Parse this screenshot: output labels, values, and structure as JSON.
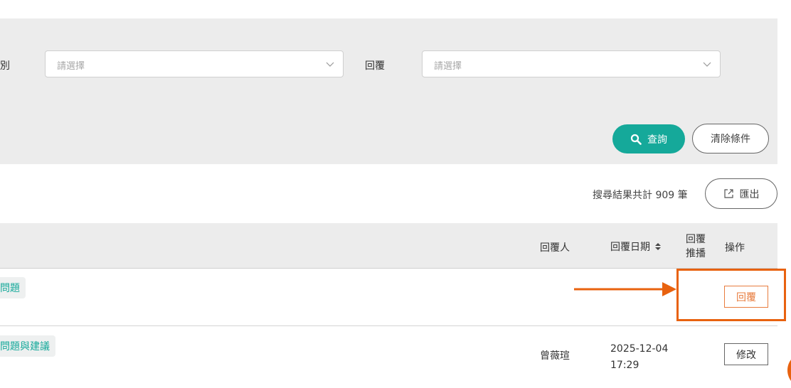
{
  "filters": {
    "category_label_partial": "別",
    "category_placeholder": "請選擇",
    "reply_label": "回覆",
    "reply_placeholder": "請選擇",
    "query_button": "查詢",
    "clear_button": "清除條件"
  },
  "results": {
    "count_text": "搜尋結果共計 909 筆",
    "export_button": "匯出"
  },
  "table": {
    "headers": {
      "replier": "回覆人",
      "reply_date": "回覆日期",
      "reply_push_line1": "回覆",
      "reply_push_line2": "推播",
      "actions": "操作"
    },
    "rows": [
      {
        "tag": "問題",
        "replier": "",
        "date": "",
        "time": "",
        "action": "回覆"
      },
      {
        "tag": "問題與建議",
        "replier": "曾薇瑄",
        "date": "2025-12-04",
        "time": "17:29",
        "action": "修改"
      }
    ]
  },
  "colors": {
    "accent_teal": "#15a99a",
    "annotation_orange": "#e8620f",
    "reply_button_orange": "#e87c3e"
  }
}
